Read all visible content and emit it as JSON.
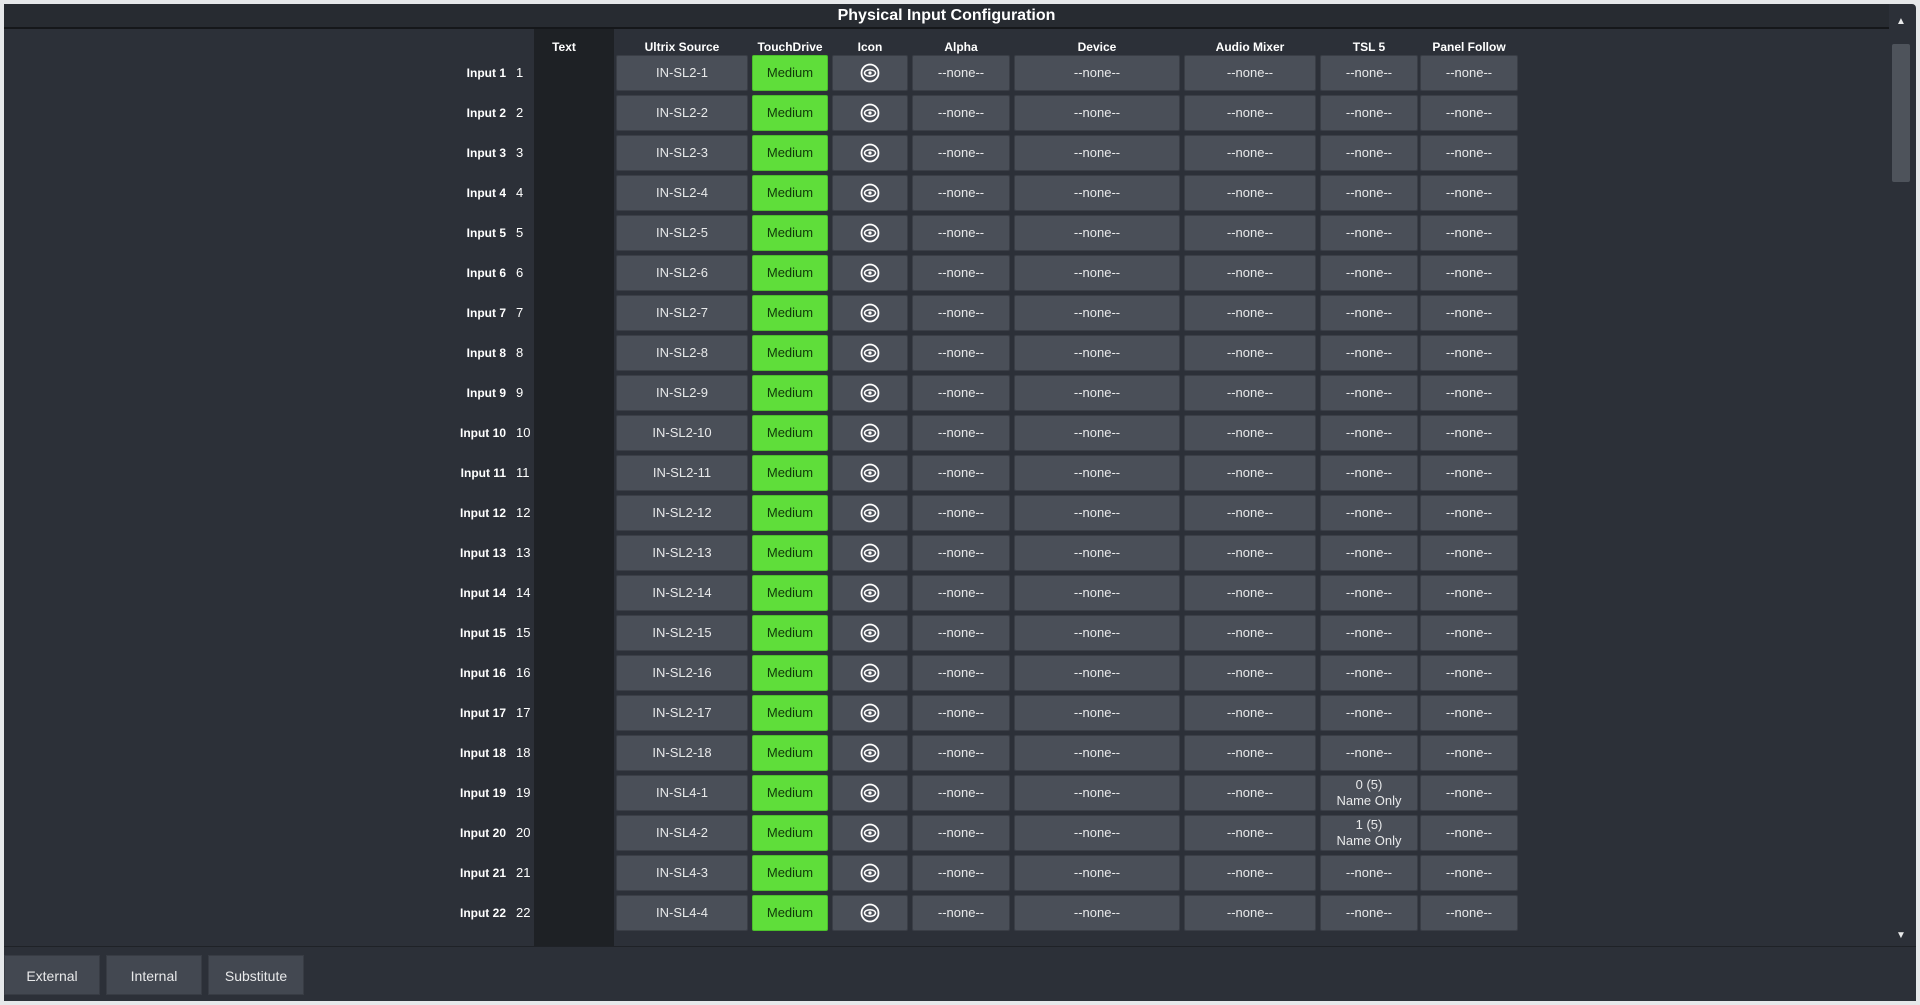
{
  "window": {
    "title": "Physical Input Configuration"
  },
  "columns": {
    "text": "Text",
    "ultrix_source": "Ultrix Source",
    "touchdrive": "TouchDrive",
    "icon": "Icon",
    "alpha": "Alpha",
    "device": "Device",
    "audio_mixer": "Audio Mixer",
    "tsl5": "TSL 5",
    "panel_follow": "Panel Follow"
  },
  "rows": [
    {
      "label": "Input 1",
      "text": "1",
      "source": "IN-SL2-1",
      "touchdrive": "Medium",
      "alpha": "--none--",
      "device": "--none--",
      "audio": "--none--",
      "tsl5": "--none--",
      "tsl5_sub": "",
      "panel": "--none--"
    },
    {
      "label": "Input 2",
      "text": "2",
      "source": "IN-SL2-2",
      "touchdrive": "Medium",
      "alpha": "--none--",
      "device": "--none--",
      "audio": "--none--",
      "tsl5": "--none--",
      "tsl5_sub": "",
      "panel": "--none--"
    },
    {
      "label": "Input 3",
      "text": "3",
      "source": "IN-SL2-3",
      "touchdrive": "Medium",
      "alpha": "--none--",
      "device": "--none--",
      "audio": "--none--",
      "tsl5": "--none--",
      "tsl5_sub": "",
      "panel": "--none--"
    },
    {
      "label": "Input 4",
      "text": "4",
      "source": "IN-SL2-4",
      "touchdrive": "Medium",
      "alpha": "--none--",
      "device": "--none--",
      "audio": "--none--",
      "tsl5": "--none--",
      "tsl5_sub": "",
      "panel": "--none--"
    },
    {
      "label": "Input 5",
      "text": "5",
      "source": "IN-SL2-5",
      "touchdrive": "Medium",
      "alpha": "--none--",
      "device": "--none--",
      "audio": "--none--",
      "tsl5": "--none--",
      "tsl5_sub": "",
      "panel": "--none--"
    },
    {
      "label": "Input 6",
      "text": "6",
      "source": "IN-SL2-6",
      "touchdrive": "Medium",
      "alpha": "--none--",
      "device": "--none--",
      "audio": "--none--",
      "tsl5": "--none--",
      "tsl5_sub": "",
      "panel": "--none--"
    },
    {
      "label": "Input 7",
      "text": "7",
      "source": "IN-SL2-7",
      "touchdrive": "Medium",
      "alpha": "--none--",
      "device": "--none--",
      "audio": "--none--",
      "tsl5": "--none--",
      "tsl5_sub": "",
      "panel": "--none--"
    },
    {
      "label": "Input 8",
      "text": "8",
      "source": "IN-SL2-8",
      "touchdrive": "Medium",
      "alpha": "--none--",
      "device": "--none--",
      "audio": "--none--",
      "tsl5": "--none--",
      "tsl5_sub": "",
      "panel": "--none--"
    },
    {
      "label": "Input 9",
      "text": "9",
      "source": "IN-SL2-9",
      "touchdrive": "Medium",
      "alpha": "--none--",
      "device": "--none--",
      "audio": "--none--",
      "tsl5": "--none--",
      "tsl5_sub": "",
      "panel": "--none--"
    },
    {
      "label": "Input 10",
      "text": "10",
      "source": "IN-SL2-10",
      "touchdrive": "Medium",
      "alpha": "--none--",
      "device": "--none--",
      "audio": "--none--",
      "tsl5": "--none--",
      "tsl5_sub": "",
      "panel": "--none--"
    },
    {
      "label": "Input 11",
      "text": "11",
      "source": "IN-SL2-11",
      "touchdrive": "Medium",
      "alpha": "--none--",
      "device": "--none--",
      "audio": "--none--",
      "tsl5": "--none--",
      "tsl5_sub": "",
      "panel": "--none--"
    },
    {
      "label": "Input 12",
      "text": "12",
      "source": "IN-SL2-12",
      "touchdrive": "Medium",
      "alpha": "--none--",
      "device": "--none--",
      "audio": "--none--",
      "tsl5": "--none--",
      "tsl5_sub": "",
      "panel": "--none--"
    },
    {
      "label": "Input 13",
      "text": "13",
      "source": "IN-SL2-13",
      "touchdrive": "Medium",
      "alpha": "--none--",
      "device": "--none--",
      "audio": "--none--",
      "tsl5": "--none--",
      "tsl5_sub": "",
      "panel": "--none--"
    },
    {
      "label": "Input 14",
      "text": "14",
      "source": "IN-SL2-14",
      "touchdrive": "Medium",
      "alpha": "--none--",
      "device": "--none--",
      "audio": "--none--",
      "tsl5": "--none--",
      "tsl5_sub": "",
      "panel": "--none--"
    },
    {
      "label": "Input 15",
      "text": "15",
      "source": "IN-SL2-15",
      "touchdrive": "Medium",
      "alpha": "--none--",
      "device": "--none--",
      "audio": "--none--",
      "tsl5": "--none--",
      "tsl5_sub": "",
      "panel": "--none--"
    },
    {
      "label": "Input 16",
      "text": "16",
      "source": "IN-SL2-16",
      "touchdrive": "Medium",
      "alpha": "--none--",
      "device": "--none--",
      "audio": "--none--",
      "tsl5": "--none--",
      "tsl5_sub": "",
      "panel": "--none--"
    },
    {
      "label": "Input 17",
      "text": "17",
      "source": "IN-SL2-17",
      "touchdrive": "Medium",
      "alpha": "--none--",
      "device": "--none--",
      "audio": "--none--",
      "tsl5": "--none--",
      "tsl5_sub": "",
      "panel": "--none--"
    },
    {
      "label": "Input 18",
      "text": "18",
      "source": "IN-SL2-18",
      "touchdrive": "Medium",
      "alpha": "--none--",
      "device": "--none--",
      "audio": "--none--",
      "tsl5": "--none--",
      "tsl5_sub": "",
      "panel": "--none--"
    },
    {
      "label": "Input 19",
      "text": "19",
      "source": "IN-SL4-1",
      "touchdrive": "Medium",
      "alpha": "--none--",
      "device": "--none--",
      "audio": "--none--",
      "tsl5": "0 (5)",
      "tsl5_sub": "Name Only",
      "panel": "--none--"
    },
    {
      "label": "Input 20",
      "text": "20",
      "source": "IN-SL4-2",
      "touchdrive": "Medium",
      "alpha": "--none--",
      "device": "--none--",
      "audio": "--none--",
      "tsl5": "1 (5)",
      "tsl5_sub": "Name Only",
      "panel": "--none--"
    },
    {
      "label": "Input 21",
      "text": "21",
      "source": "IN-SL4-3",
      "touchdrive": "Medium",
      "alpha": "--none--",
      "device": "--none--",
      "audio": "--none--",
      "tsl5": "--none--",
      "tsl5_sub": "",
      "panel": "--none--"
    },
    {
      "label": "Input 22",
      "text": "22",
      "source": "IN-SL4-4",
      "touchdrive": "Medium",
      "alpha": "--none--",
      "device": "--none--",
      "audio": "--none--",
      "tsl5": "--none--",
      "tsl5_sub": "",
      "panel": "--none--"
    }
  ],
  "icons": {
    "row_icon": "eye-icon",
    "scroll_up": "arrow-up-icon",
    "scroll_down": "arrow-down-icon"
  },
  "scroll": {
    "position": 0.0
  },
  "tabs": [
    {
      "label": "External",
      "active": true
    },
    {
      "label": "Internal",
      "active": false
    },
    {
      "label": "Substitute",
      "active": false
    }
  ],
  "colors": {
    "accent": "#3a9de0",
    "touchdrive": "#5fde3a"
  }
}
